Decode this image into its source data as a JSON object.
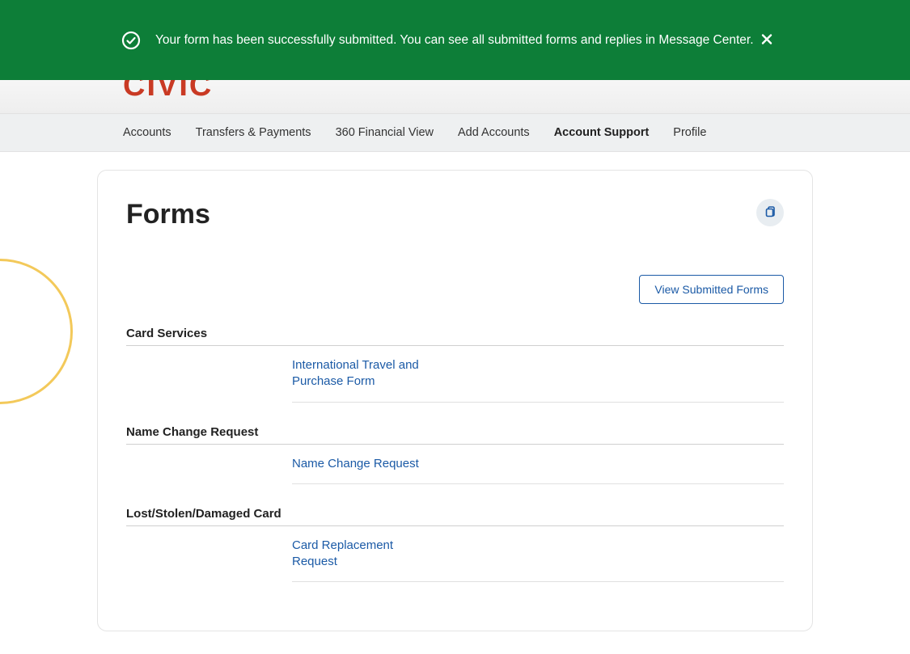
{
  "banner": {
    "message": "Your form has been successfully submitted. You can see all submitted forms and replies in Message Center."
  },
  "logo": "CIVIC",
  "nav": {
    "items": [
      {
        "label": "Accounts",
        "active": false
      },
      {
        "label": "Transfers & Payments",
        "active": false
      },
      {
        "label": "360 Financial View",
        "active": false
      },
      {
        "label": "Add Accounts",
        "active": false
      },
      {
        "label": "Account Support",
        "active": true
      },
      {
        "label": "Profile",
        "active": false
      }
    ]
  },
  "page": {
    "title": "Forms",
    "view_submitted_label": "View Submitted Forms"
  },
  "sections": [
    {
      "title": "Card Services",
      "link": "International Travel and Purchase Form"
    },
    {
      "title": "Name Change Request",
      "link": "Name Change Request"
    },
    {
      "title": "Lost/Stolen/Damaged Card",
      "link": "Card Replacement Request"
    }
  ]
}
